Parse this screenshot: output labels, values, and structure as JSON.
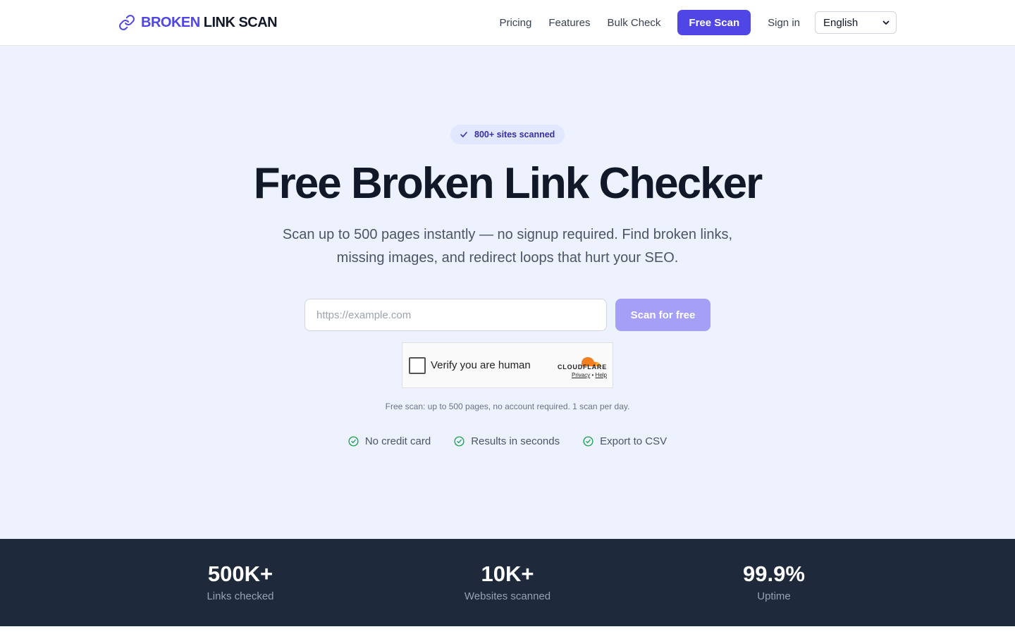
{
  "header": {
    "logo_part1": "BROKEN",
    "logo_part2": "LINK SCAN",
    "nav": {
      "pricing": "Pricing",
      "features": "Features",
      "bulk_check": "Bulk Check",
      "free_scan": "Free Scan",
      "sign_in": "Sign in"
    },
    "language": "English"
  },
  "hero": {
    "badge": "800+ sites scanned",
    "title": "Free Broken Link Checker",
    "subtitle": "Scan up to 500 pages instantly — no signup required. Find broken links, missing images, and redirect loops that hurt your SEO.",
    "url_placeholder": "https://example.com",
    "scan_button": "Scan for free",
    "captcha": {
      "label": "Verify you are human",
      "brand": "CLOUDFLARE",
      "privacy": "Privacy",
      "separator": "•",
      "help": "Help"
    },
    "note": "Free scan: up to 500 pages, no account required. 1 scan per day.",
    "features": [
      "No credit card",
      "Results in seconds",
      "Export to CSV"
    ]
  },
  "stats": [
    {
      "value": "500K+",
      "label": "Links checked"
    },
    {
      "value": "10K+",
      "label": "Websites scanned"
    },
    {
      "value": "99.9%",
      "label": "Uptime"
    }
  ],
  "colors": {
    "brand": "#4f46e5",
    "hero_bg": "#eef2ff",
    "stats_bg": "#1e293b",
    "check_green": "#16a34a",
    "cloudflare_orange": "#f38020"
  },
  "icons": {
    "logo": "link-icon",
    "badge": "check-icon",
    "features": "check-circle-icon",
    "language": "chevron-down-icon"
  }
}
